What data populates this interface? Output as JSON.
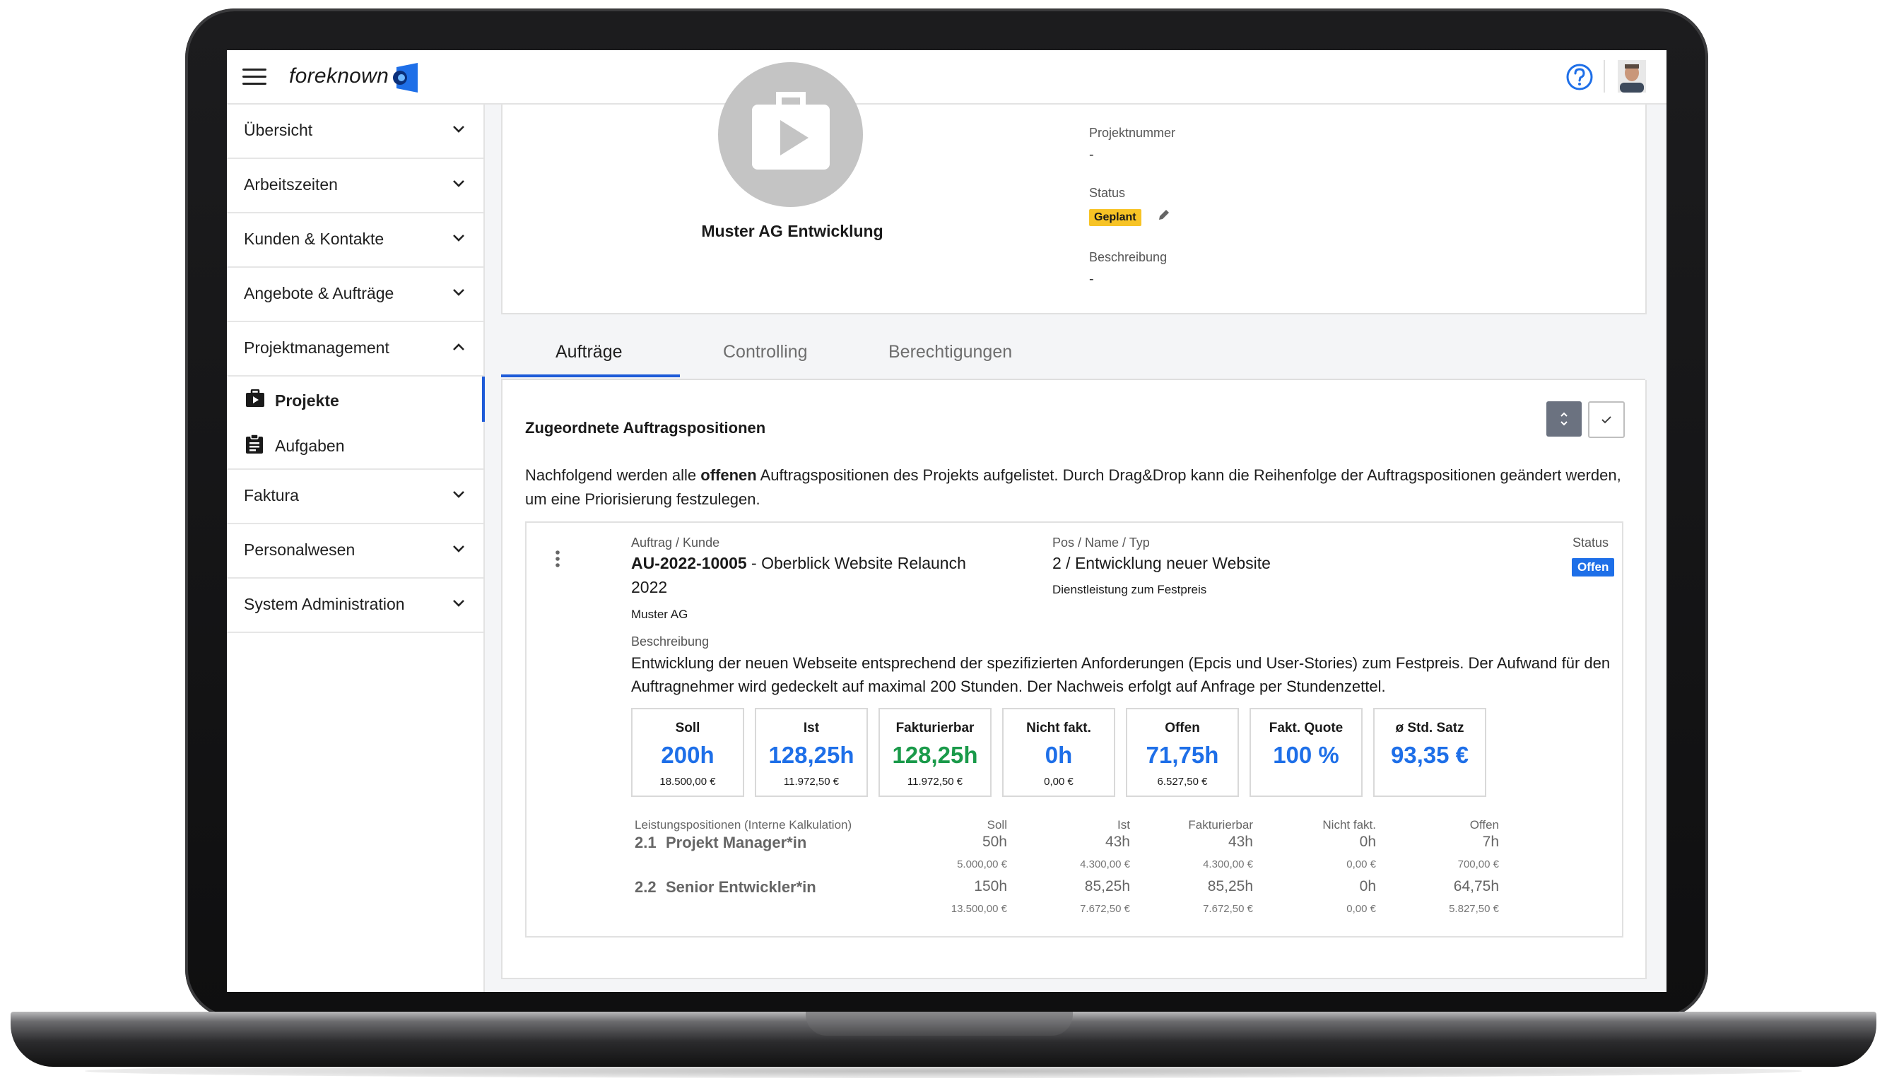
{
  "header": {
    "logo_text": "foreknown"
  },
  "sidebar": {
    "items": [
      {
        "label": "Übersicht"
      },
      {
        "label": "Arbeitszeiten"
      },
      {
        "label": "Kunden & Kontakte"
      },
      {
        "label": "Angebote & Aufträge"
      },
      {
        "label": "Projektmanagement"
      },
      {
        "label": "Faktura"
      },
      {
        "label": "Personalwesen"
      },
      {
        "label": "System Administration"
      }
    ],
    "sub_items": [
      {
        "label": "Projekte",
        "active": true
      },
      {
        "label": "Aufgaben",
        "active": false
      }
    ]
  },
  "project": {
    "name": "Muster AG Entwicklung",
    "fields": {
      "number_label": "Projektnummer",
      "number_value": "-",
      "status_label": "Status",
      "status_value": "Geplant",
      "description_label": "Beschreibung",
      "description_value": "-"
    }
  },
  "tabs": [
    {
      "label": "Aufträge",
      "active": true
    },
    {
      "label": "Controlling",
      "active": false
    },
    {
      "label": "Berechtigungen",
      "active": false
    }
  ],
  "section": {
    "title": "Zugeordnete Auftragspositionen",
    "intro_pre": "Nachfolgend werden alle ",
    "intro_bold": "offenen",
    "intro_post": " Auftragspositionen des Projekts aufgelistet. Durch Drag&Drop kann die Reihenfolge der Auftragspositionen geändert werden, um eine Priorisierung festzulegen."
  },
  "position": {
    "order_label": "Auftrag / Kunde",
    "order_number": "AU-2022-10005",
    "order_title": " - Oberblick Website Relaunch 2022",
    "customer": "Muster AG",
    "pos_label": "Pos / Name / Typ",
    "pos_name": "2 / Entwicklung neuer Website",
    "pos_type": "Dienstleistung zum Festpreis",
    "status_label": "Status",
    "status_value": "Offen",
    "desc_label": "Beschreibung",
    "desc_text": "Entwicklung der neuen Webseite entsprechend der spezifizierten Anforderungen (Epcis und User-Stories) zum Festpreis. Der Aufwand für den Auftragnehmer wird gedeckelt auf maximal 200 Stunden. Der Nachweis erfolgt auf Anfrage per Stundenzettel."
  },
  "kpis": [
    {
      "label": "Soll",
      "value": "200h",
      "sub": "18.500,00 €",
      "color": "#1e6fe8"
    },
    {
      "label": "Ist",
      "value": "128,25h",
      "sub": "11.972,50 €",
      "color": "#1e6fe8"
    },
    {
      "label": "Fakturierbar",
      "value": "128,25h",
      "sub": "11.972,50 €",
      "color": "#1a9a4a"
    },
    {
      "label": "Nicht fakt.",
      "value": "0h",
      "sub": "0,00 €",
      "color": "#1e6fe8"
    },
    {
      "label": "Offen",
      "value": "71,75h",
      "sub": "6.527,50 €",
      "color": "#1e6fe8"
    },
    {
      "label": "Fakt. Quote",
      "value": "100 %",
      "sub": "",
      "color": "#1e6fe8"
    },
    {
      "label": "ø Std. Satz",
      "value": "93,35 €",
      "sub": "",
      "color": "#1e6fe8"
    }
  ],
  "services": {
    "headers": [
      "Leistungspositionen  (Interne Kalkulation)",
      "Soll",
      "Ist",
      "Fakturierbar",
      "Nicht fakt.",
      "Offen"
    ],
    "rows": [
      {
        "num": "2.1",
        "name": "Projekt Manager*in",
        "hours": [
          "50h",
          "43h",
          "43h",
          "0h",
          "7h"
        ],
        "amounts": [
          "5.000,00 €",
          "4.300,00 €",
          "4.300,00 €",
          "0,00 €",
          "700,00 €"
        ]
      },
      {
        "num": "2.2",
        "name": "Senior Entwickler*in",
        "hours": [
          "150h",
          "85,25h",
          "85,25h",
          "0h",
          "64,75h"
        ],
        "amounts": [
          "13.500,00 €",
          "7.672,50 €",
          "7.672,50 €",
          "0,00 €",
          "5.827,50 €"
        ]
      }
    ]
  }
}
